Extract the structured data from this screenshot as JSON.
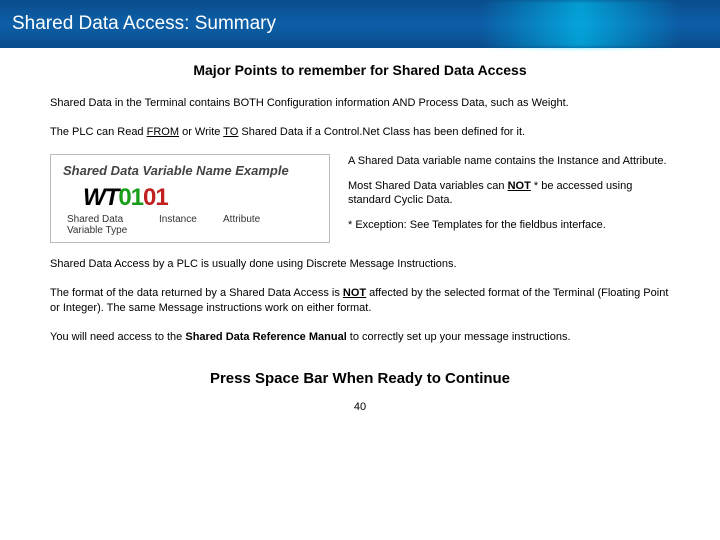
{
  "header": {
    "title": "Shared Data Access: Summary"
  },
  "subtitle": "Major Points to remember for Shared Data Access",
  "p1": "Shared Data in the Terminal contains BOTH Configuration information AND Process Data, such as Weight.",
  "p2_a": "The PLC can Read ",
  "p2_from": "FROM",
  "p2_b": " or Write ",
  "p2_to": "TO",
  "p2_c": " Shared Data if a Control.Net Class has been defined for it.",
  "diagram": {
    "title": "Shared Data Variable Name Example",
    "wt": "WT",
    "inst": "01",
    "attr": "01",
    "label_type": "Shared Data Variable Type",
    "label_instance": "Instance",
    "label_attribute": "Attribute"
  },
  "right": {
    "r1": "A Shared Data variable name contains the Instance and Attribute.",
    "r2_a": "Most Shared Data variables can ",
    "r2_not": "NOT",
    "r2_b": " * be accessed using standard Cyclic Data.",
    "r3": "* Exception:  See Templates for the fieldbus interface."
  },
  "p3": "Shared Data Access by a PLC is usually done using Discrete Message Instructions.",
  "p4_a": "The format of the data returned by a Shared Data Access is ",
  "p4_not": "NOT",
  "p4_b": " affected by the selected format of the Terminal (Floating Point or Integer).  The same Message instructions work on either format.",
  "p5_a": "You will need access to the ",
  "p5_bold": "Shared Data Reference Manual",
  "p5_b": " to correctly set up your message instructions.",
  "cta": "Press Space Bar When Ready to Continue",
  "page": "40"
}
